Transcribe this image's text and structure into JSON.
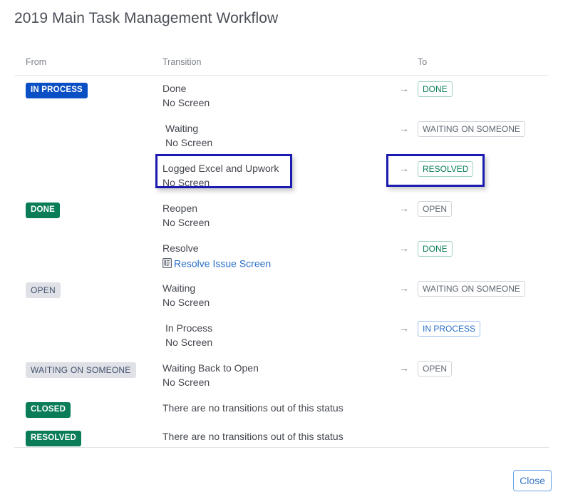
{
  "page_title": "2019 Main Task Management Workflow",
  "columns": {
    "from": "From",
    "transition": "Transition",
    "to": "To"
  },
  "no_screen_label": "No Screen",
  "no_transitions_label": "There are no transitions out of this status",
  "arrow_glyph": "→",
  "screen_icon_name": "screen-form-icon",
  "colors": {
    "badge_blue": "#0b4fc4",
    "badge_green": "#0a7d58",
    "badge_grey_bg": "#dfe1e6",
    "badge_grey_text": "#42526e",
    "outline_green": "#0a7d58",
    "outline_blue": "#2a6fc9",
    "outline_grey": "#5e6572",
    "highlight": "#1b1bb0",
    "link": "#2a6fc9",
    "divider": "#e2e3e5",
    "title_text": "#4a4f57"
  },
  "statuses": [
    {
      "name": "IN PROCESS",
      "style": "blue",
      "transitions": [
        {
          "name": "Done",
          "screen": "No Screen",
          "screen_link": null,
          "to": "DONE",
          "to_style": "green",
          "indent": false,
          "highlighted": false
        },
        {
          "name": "Waiting",
          "screen": "No Screen",
          "screen_link": null,
          "to": "WAITING ON SOMEONE",
          "to_style": "grey",
          "indent": true,
          "highlighted": false
        },
        {
          "name": "Logged Excel and Upwork",
          "screen": "No Screen",
          "screen_link": null,
          "to": "RESOLVED",
          "to_style": "green",
          "indent": false,
          "highlighted": true
        }
      ]
    },
    {
      "name": "DONE",
      "style": "green",
      "transitions": [
        {
          "name": "Reopen",
          "screen": "No Screen",
          "screen_link": null,
          "to": "OPEN",
          "to_style": "grey",
          "indent": false,
          "highlighted": false
        },
        {
          "name": "Resolve",
          "screen": null,
          "screen_link": "Resolve Issue Screen",
          "to": "DONE",
          "to_style": "green",
          "indent": false,
          "highlighted": false
        }
      ]
    },
    {
      "name": "OPEN",
      "style": "grey",
      "transitions": [
        {
          "name": "Waiting",
          "screen": "No Screen",
          "screen_link": null,
          "to": "WAITING ON SOMEONE",
          "to_style": "grey",
          "indent": false,
          "highlighted": false
        },
        {
          "name": "In Process",
          "screen": "No Screen",
          "screen_link": null,
          "to": "IN PROCESS",
          "to_style": "blue",
          "indent": true,
          "highlighted": false
        }
      ]
    },
    {
      "name": "WAITING ON SOMEONE",
      "style": "grey",
      "transitions": [
        {
          "name": "Waiting Back to Open",
          "screen": "No Screen",
          "screen_link": null,
          "to": "OPEN",
          "to_style": "grey",
          "indent": false,
          "highlighted": false
        }
      ]
    },
    {
      "name": "CLOSED",
      "style": "green",
      "transitions": []
    },
    {
      "name": "RESOLVED",
      "style": "green",
      "transitions": []
    }
  ],
  "footer": {
    "close_label": "Close"
  }
}
